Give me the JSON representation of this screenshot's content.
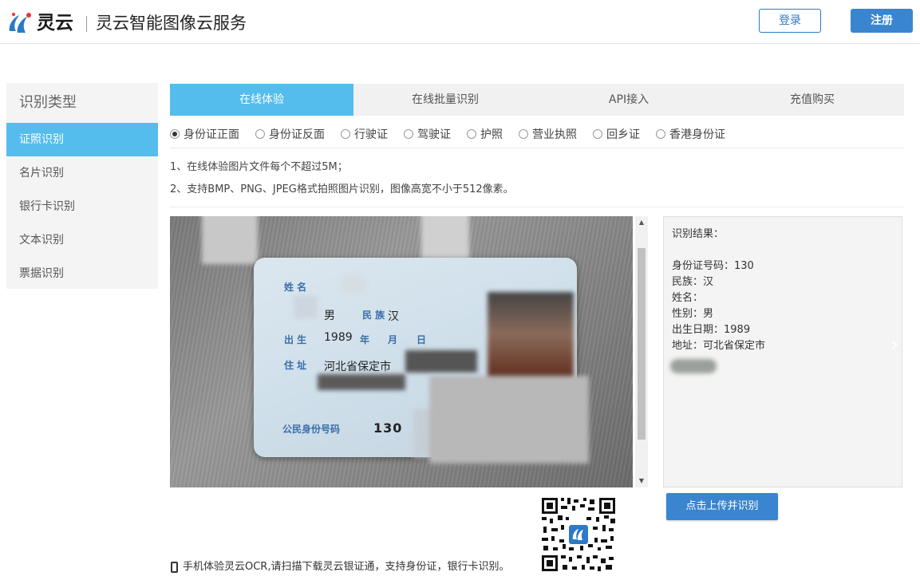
{
  "header": {
    "brand": "灵云",
    "site_title": "灵云智能图像云服务",
    "login_label": "登录",
    "register_label": "注册",
    "brand_color": "#3a85cf"
  },
  "sidebar": {
    "title": "识别类型",
    "items": [
      {
        "label": "证照识别",
        "active": true
      },
      {
        "label": "名片识别"
      },
      {
        "label": "银行卡识别"
      },
      {
        "label": "文本识别"
      },
      {
        "label": "票据识别"
      }
    ]
  },
  "tabs": [
    {
      "label": "在线体验",
      "active": true
    },
    {
      "label": "在线批量识别"
    },
    {
      "label": "API接入"
    },
    {
      "label": "充值购买"
    }
  ],
  "doc_types": [
    {
      "label": "身份证正面",
      "checked": true
    },
    {
      "label": "身份证反面"
    },
    {
      "label": "行驶证"
    },
    {
      "label": "驾驶证"
    },
    {
      "label": "护照"
    },
    {
      "label": "营业执照"
    },
    {
      "label": "回乡证"
    },
    {
      "label": "香港身份证"
    }
  ],
  "notes": [
    "1、在线体验图片文件每个不超过5M；",
    "2、支持BMP、PNG、JPEG格式拍照图片识别，图像高宽不小于512像素。"
  ],
  "id_card": {
    "name_label": "姓 名",
    "gender": "男",
    "ethnicity_label": "民 族",
    "ethnicity": "汉",
    "birth_label": "出 生",
    "birth_year": "1989",
    "year_char": "年",
    "month_char": "月",
    "day_char": "日",
    "address_label": "住 址",
    "address": "河北省保定市",
    "id_label": "公民身份号码",
    "id_number": "130"
  },
  "result": {
    "title": "识别结果：",
    "lines": [
      "身份证号码：130",
      "民族：汉",
      "姓名：",
      "性别：男",
      "出生日期：1989",
      "地址：可北省保定市"
    ]
  },
  "upload_label": "点击上传并识别",
  "mobile_note": "手机体验灵云OCR,请扫描下载灵云银证通，支持身份证，银行卡识别。",
  "accent_color": "#55bcee"
}
